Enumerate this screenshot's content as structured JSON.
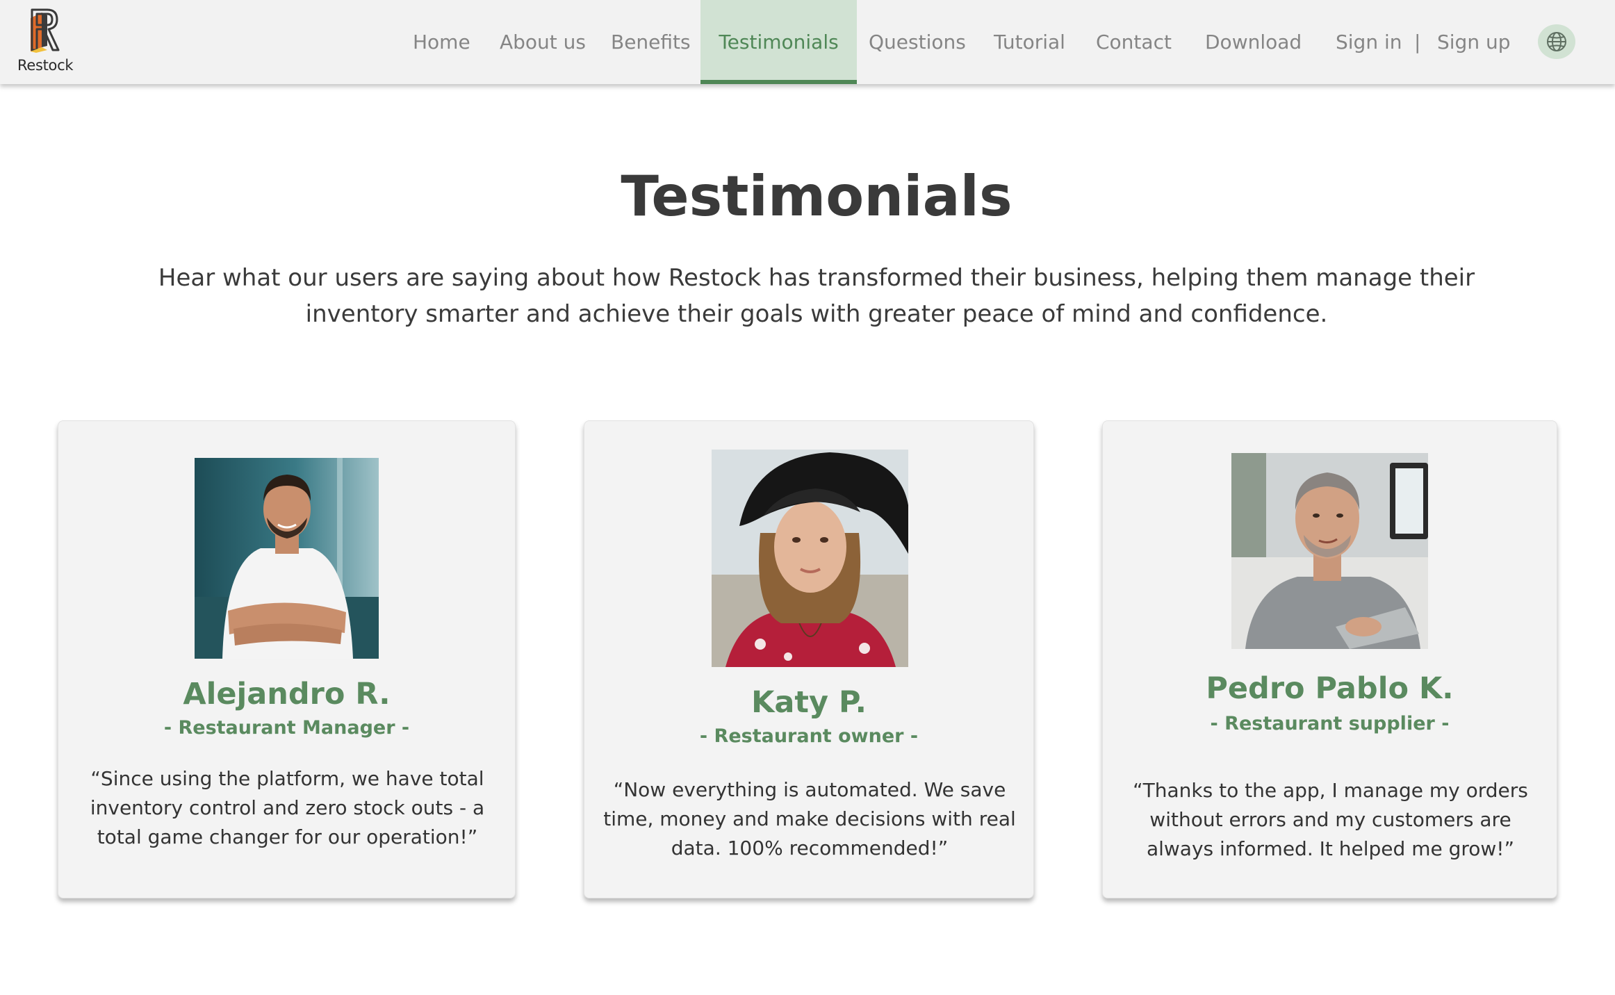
{
  "brand": {
    "name": "Restock",
    "accent_color": "#4f8756",
    "accent_light": "#d1e2d3"
  },
  "nav": {
    "items": [
      {
        "label": "Home"
      },
      {
        "label": "About us"
      },
      {
        "label": "Benefits"
      },
      {
        "label": "Testimonials",
        "active": true
      },
      {
        "label": "Questions"
      },
      {
        "label": "Tutorial"
      },
      {
        "label": "Contact"
      },
      {
        "label": "Download"
      }
    ],
    "sign_in": "Sign in",
    "separator": "|",
    "sign_up": "Sign up",
    "language_icon": "globe-icon"
  },
  "hero": {
    "title": "Testimonials",
    "subtitle": "Hear what our users are saying about how Restock has transformed their business, helping them manage their inventory smarter and achieve their goals with greater peace of mind and confidence."
  },
  "testimonials": [
    {
      "name": "Alejandro R.",
      "role": "- Restaurant Manager -",
      "quote": "“Since using the platform, we have total inventory control and zero stock outs - a total game changer for our operation!”"
    },
    {
      "name": "Katy P.",
      "role": "- Restaurant owner -",
      "quote": "“Now everything is automated. We save time, money and make decisions with real data. 100% recommended!”"
    },
    {
      "name": "Pedro Pablo K.",
      "role": "- Restaurant supplier -",
      "quote": "“Thanks to the app, I manage my orders without errors and my customers are always informed. It helped me grow!”"
    }
  ]
}
